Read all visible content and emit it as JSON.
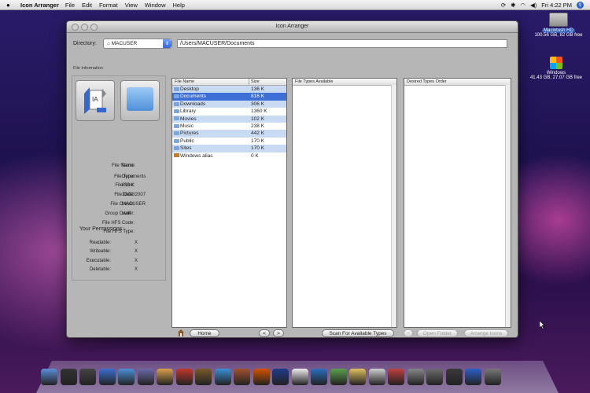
{
  "menubar": {
    "app": "Icon Arranger",
    "items": [
      "File",
      "Edit",
      "Format",
      "View",
      "Window",
      "Help"
    ],
    "clock": "Fri 4:22 PM"
  },
  "desktop": {
    "hd_name": "Macintosh HD",
    "hd_info": "100.56 GB, 82 GB free",
    "win_name": "Windows",
    "win_info": "41.43 GB, 27.07 GB free"
  },
  "window": {
    "title": "Icon Arranger",
    "directory_label": "Directory:",
    "directory_value": "MACUSER",
    "path": "/Users/MACUSER/Documents"
  },
  "file_info": {
    "heading": "File Information",
    "rows": [
      {
        "label": "File Name:",
        "value": "Name"
      },
      {
        "label": "File Type:",
        "value": "Documents"
      },
      {
        "label": "File Size:",
        "value": "816 K"
      },
      {
        "label": "File Date:",
        "value": "10/02/2007"
      },
      {
        "label": "File Owner:",
        "value": "MACUSER"
      },
      {
        "label": "Group Owner:",
        "value": "staff"
      },
      {
        "label": "File HFS Code:",
        "value": ""
      },
      {
        "label": "File HFS Type:",
        "value": ""
      }
    ],
    "permissions_heading": "Your Permissions:",
    "permissions": [
      {
        "label": "Readable:",
        "value": "X"
      },
      {
        "label": "Writeable:",
        "value": "X"
      },
      {
        "label": "Executable:",
        "value": "X"
      },
      {
        "label": "Deletable:",
        "value": "X"
      }
    ]
  },
  "file_list": {
    "col_name": "File Name",
    "col_size": "Size",
    "rows": [
      {
        "name": "Desktop",
        "size": "136 K"
      },
      {
        "name": "Documents",
        "size": "816 K"
      },
      {
        "name": "Downloads",
        "size": "306 K"
      },
      {
        "name": "Library",
        "size": "1360 K"
      },
      {
        "name": "Movies",
        "size": "102 K"
      },
      {
        "name": "Music",
        "size": "238 K"
      },
      {
        "name": "Pictures",
        "size": "442 K"
      },
      {
        "name": "Public",
        "size": "170 K"
      },
      {
        "name": "Sites",
        "size": "170 K"
      },
      {
        "name": "Windows alias",
        "size": "0 K"
      }
    ]
  },
  "columns": {
    "types_available": "File Types Available",
    "desired_order": "Desired Types Order"
  },
  "buttons": {
    "home": "Home",
    "prev": "<",
    "next": ">",
    "scan": "Scan For Available Types",
    "minus": "−",
    "open_folder": "Open Folder",
    "arrange": "Arrange Icons"
  },
  "colors": {
    "selection": "#3d6fd6",
    "alt_row": "#c9dbf3"
  }
}
